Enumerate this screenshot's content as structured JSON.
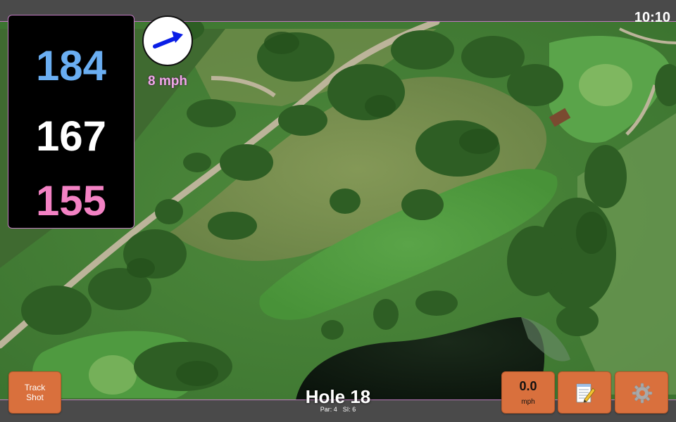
{
  "status_bar": {
    "clock": "10:10"
  },
  "distances": {
    "back": "184",
    "middle": "167",
    "front": "155"
  },
  "wind": {
    "speed_label": "8 mph",
    "arrow_icon": "wind-direction-arrow-icon",
    "arrow_color": "#0a1ee6"
  },
  "hole": {
    "title": "Hole 18",
    "par_label": "Par: 4",
    "stroke_index_label": "SI: 6"
  },
  "controls": {
    "track_shot_line1": "Track",
    "track_shot_line2": "Shot",
    "speed_value": "0.0",
    "speed_unit": "mph",
    "notes_icon": "notepad-pencil-icon",
    "settings_icon": "gear-icon"
  },
  "colors": {
    "back_distance": "#6aaef2",
    "middle_distance": "#ffffff",
    "front_distance": "#f382c4",
    "button_orange": "#d9703d",
    "bar_grey": "#4a4a4a",
    "accent_border": "#c07ac0"
  }
}
